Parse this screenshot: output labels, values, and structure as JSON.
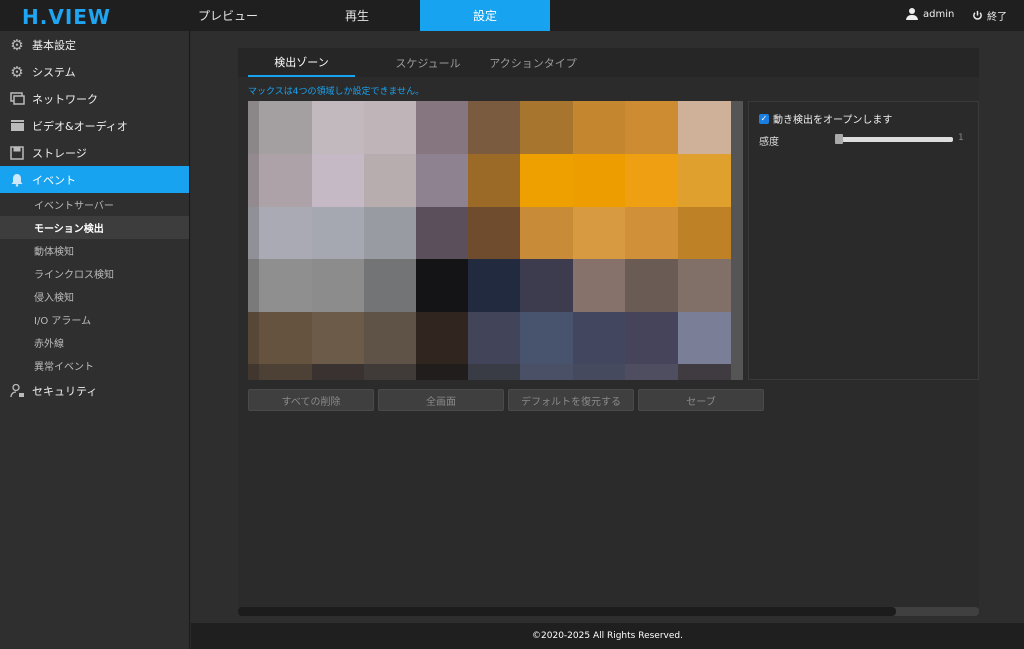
{
  "header": {
    "logo": "H.VIEW",
    "nav": [
      "プレビュー",
      "再生",
      "設定"
    ],
    "active_nav": 2,
    "user": "admin",
    "logout": "終了"
  },
  "sidebar": {
    "items": [
      {
        "label": "基本設定",
        "icon": "gear-icon"
      },
      {
        "label": "システム",
        "icon": "gears-icon"
      },
      {
        "label": "ネットワーク",
        "icon": "network-icon"
      },
      {
        "label": "ビデオ&オーディオ",
        "icon": "clapper-icon"
      },
      {
        "label": "ストレージ",
        "icon": "floppy-icon"
      },
      {
        "label": "イベント",
        "icon": "bell-icon"
      }
    ],
    "event_sub": [
      "イベントサーバー",
      "モーション検出",
      "動体検知",
      "ラインクロス検知",
      "侵入検知",
      "I/O アラーム",
      "赤外線",
      "異常イベント"
    ],
    "security": {
      "label": "セキュリティ",
      "icon": "person-lock-icon"
    }
  },
  "tabs": [
    "検出ゾーン",
    "スケジュール",
    "アクションタイプ"
  ],
  "notice": "マックスは4つの領域しか設定できません。",
  "settings": {
    "enable_label": "動き検出をオープンします",
    "enabled": true,
    "sensitivity_label": "感度",
    "sensitivity_value": "1"
  },
  "buttons": [
    "すべての削除",
    "全画面",
    "デフォルトを復元する",
    "セーブ"
  ],
  "footer": "©2020-2025 All Rights Reserved.",
  "colors": {
    "accent": "#18a3f0",
    "video_grid": [
      [
        "#a49fa0",
        "#c2b9bf",
        "#bfb5b8",
        "#86767f",
        "#7a5b40",
        "#a8752f",
        "#c48730",
        "#cd8c31",
        "#cfb199"
      ],
      [
        "#ada2a8",
        "#c4b9c5",
        "#b7adae",
        "#8f8290",
        "#9b6a27",
        "#eea000",
        "#ee9d00",
        "#ee9f12",
        "#dfa02d"
      ],
      [
        "#a9aab3",
        "#a6a8b1",
        "#999ba3",
        "#5a4f5a",
        "#6e4c2d",
        "#c88b37",
        "#d89a40",
        "#cf9039",
        "#bf8126"
      ],
      [
        "#8e8f8e",
        "#8c8c8c",
        "#737475",
        "#141416",
        "#222a40",
        "#3d3b4e",
        "#86726a",
        "#6a5b54",
        "#807068"
      ],
      [
        "#66533f",
        "#6c5b48",
        "#5f5247",
        "#31261f",
        "#424559",
        "#48536e",
        "#42465e",
        "#45445b",
        "#7a7e96"
      ],
      [
        "#4d4136",
        "#3a3230",
        "#403b38",
        "#201d1c",
        "#3a3c45",
        "#4a5066",
        "#454a5e",
        "#4f4d60",
        "#3f3b40"
      ]
    ]
  }
}
